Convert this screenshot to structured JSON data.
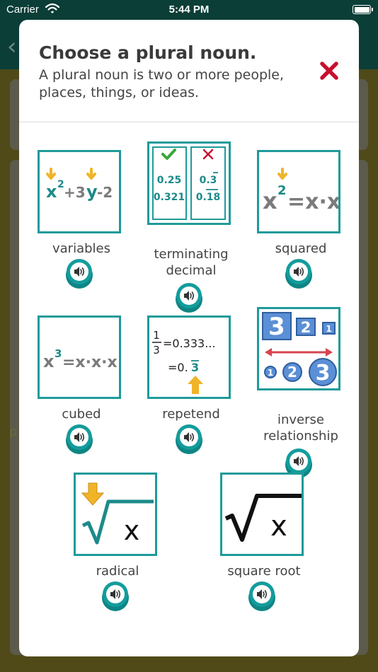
{
  "status": {
    "carrier": "Carrier",
    "time": "5:44 PM"
  },
  "modal": {
    "title": "Choose a plural noun.",
    "subtitle": "A plural noun is two or more people, places, things, or ideas."
  },
  "cards": [
    {
      "label": "variables",
      "tile": {
        "t1": "x",
        "e1": "2",
        "t2": "+3",
        "t3": "y",
        "t4": "-2"
      }
    },
    {
      "label": "terminating decimal",
      "tile": {
        "a1": "0.25",
        "a2": "0.321",
        "b1": "0.3",
        "b2": "0.18"
      }
    },
    {
      "label": "squared",
      "tile": {
        "t1": "x",
        "e1": "2",
        "t2": "=x·x"
      }
    },
    {
      "label": "cubed",
      "tile": {
        "t1": "x",
        "e1": "3",
        "t2": "=x·x·x"
      }
    },
    {
      "label": "repetend",
      "tile": {
        "num": "1",
        "den": "3",
        "line1": "=0.333...",
        "line2a": "=0.",
        "line2b": "3"
      }
    },
    {
      "label": "inverse relationship",
      "tile": {
        "s1": "3",
        "s2": "2",
        "s3": "1",
        "c1": "1",
        "c2": "2",
        "c3": "3"
      }
    },
    {
      "label": "radical",
      "tile": {
        "var": "x"
      }
    },
    {
      "label": "square root",
      "tile": {
        "var": "x"
      }
    }
  ],
  "colors": {
    "teal": "#1f9a9a",
    "arrow_yellow": "#f0b429",
    "check_green": "#3aa63a",
    "close_red": "#c8102e",
    "square_blue": "#5b8fd6",
    "math_teal": "#1d8a8a",
    "math_gray": "#7b7b7b"
  },
  "icons": {
    "close": "close-icon",
    "speaker": "speaker-icon",
    "wifi": "wifi-icon",
    "battery": "battery-icon"
  }
}
